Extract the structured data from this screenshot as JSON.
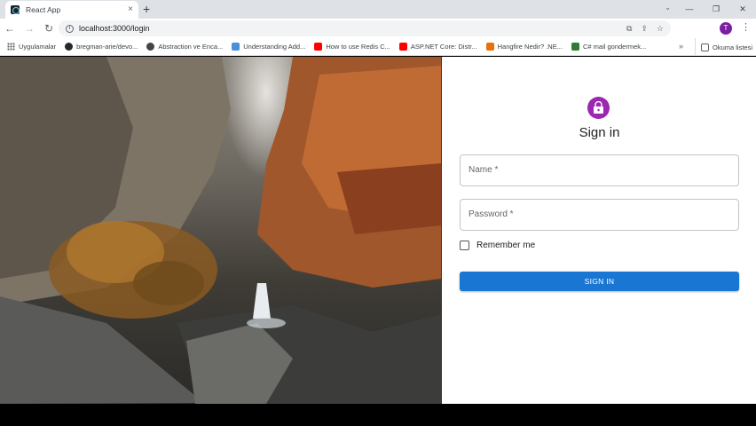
{
  "browser": {
    "tab_title": "React App",
    "tab_close": "×",
    "new_tab": "+",
    "window_controls": [
      "—",
      "❐",
      "✕"
    ],
    "url": "localhost:3000/login",
    "profile_initial": "T",
    "bookmarks": [
      {
        "label": "Uygulamalar",
        "icon": "apps-icon",
        "color": "#5f6368"
      },
      {
        "label": "bregman-arie/devo...",
        "icon": "github-icon",
        "color": "#24292e"
      },
      {
        "label": "Abstraction ve Enca...",
        "icon": "globe-icon",
        "color": "#444444"
      },
      {
        "label": "Understanding Add...",
        "icon": "page-icon",
        "color": "#4a90d9"
      },
      {
        "label": "How to use Redis C...",
        "icon": "youtube-icon",
        "color": "#ff0000"
      },
      {
        "label": "ASP.NET Core: Distr...",
        "icon": "youtube-icon",
        "color": "#ff0000"
      },
      {
        "label": "Hangfire Nedir? .NE...",
        "icon": "medium-icon",
        "color": "#e8710a"
      },
      {
        "label": "C# mail gondermek...",
        "icon": "code-icon",
        "color": "#2e7d32"
      }
    ],
    "bookmarks_overflow": "»",
    "reading_list": "Okuma listesi"
  },
  "login": {
    "title": "Sign in",
    "name_label": "Name *",
    "password_label": "Password *",
    "remember_label": "Remember me",
    "submit_label": "SIGN IN",
    "accent_color": "#9c27b0",
    "button_color": "#1976d2"
  }
}
